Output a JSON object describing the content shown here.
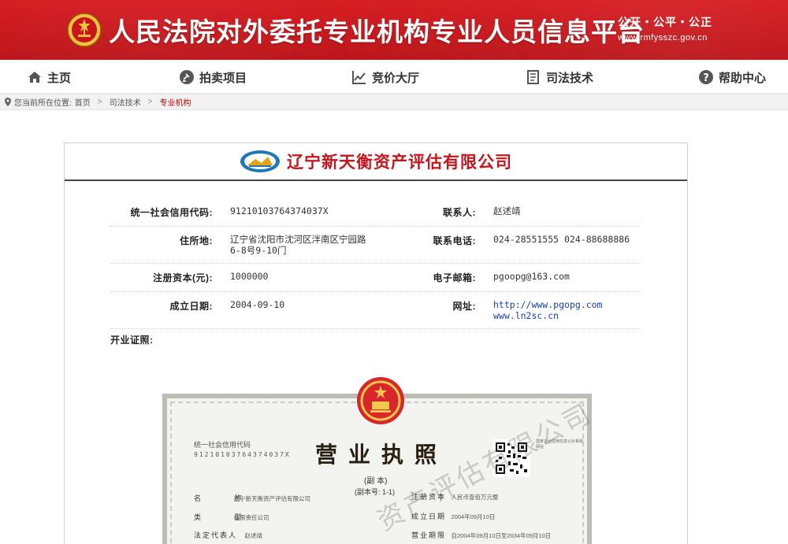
{
  "header": {
    "title": "人民法院对外委托专业机构专业人员信息平台",
    "slogan": "公开・公平・公正",
    "url": "www.rmfysszc.gov.cn",
    "brand_color": "#c8141a"
  },
  "nav": {
    "items": [
      {
        "label": "主页",
        "icon": "home-icon"
      },
      {
        "label": "拍卖项目",
        "icon": "auction-icon"
      },
      {
        "label": "竞价大厅",
        "icon": "chart-icon"
      },
      {
        "label": "司法技术",
        "icon": "document-icon"
      },
      {
        "label": "帮助中心",
        "icon": "help-icon"
      }
    ]
  },
  "breadcrumb": {
    "prefix": "您当前所在位置:",
    "items": [
      "首页",
      "司法技术",
      "专业机构"
    ],
    "sep": ">"
  },
  "company": {
    "name": "辽宁新天衡资产评估有限公司",
    "fields": {
      "credit_code_label": "统一社会信用代码:",
      "credit_code": "91210103764374037X",
      "contact_label": "联系人:",
      "contact": "赵述靖",
      "address_label": "住所地:",
      "address": "辽宁省沈阳市沈河区泮南区宁园路6-8号9-10门",
      "phone_label": "联系电话:",
      "phone": "024-28551555 024-88688886",
      "capital_label": "注册资本(元):",
      "capital": "1000000",
      "email_label": "电子邮箱:",
      "email": "pgoopg@163.com",
      "founded_label": "成立日期:",
      "founded": "2004-09-10",
      "website_label": "网址:",
      "website1": "http://www.pgopg.com",
      "website2": "www.ln2sc.cn"
    },
    "license_label": "开业证照:"
  },
  "license": {
    "title": "营业执照",
    "copy": "(副 本)",
    "copy_no": "(副本号: 1-1)",
    "code_label": "统一社会信用代码",
    "code": "91210103764374037X",
    "name_k": "名 称",
    "name_v": "辽宁新天衡资产评估有限公司",
    "type_k": "类 型",
    "type_v": "有限责任公司",
    "rep_k": "法定代表人",
    "rep_v": "赵述靖",
    "capital_k": "注册资本",
    "capital_v": "人民币壹佰万元整",
    "date_k": "成立日期",
    "date_v": "2004年09月10日",
    "term_k": "营业期限",
    "term_v": "自2004年09月10日至2034年09月10日",
    "qr_note": "国家企业信用信息公示系统网址",
    "watermark": "资产评估有限公司"
  }
}
